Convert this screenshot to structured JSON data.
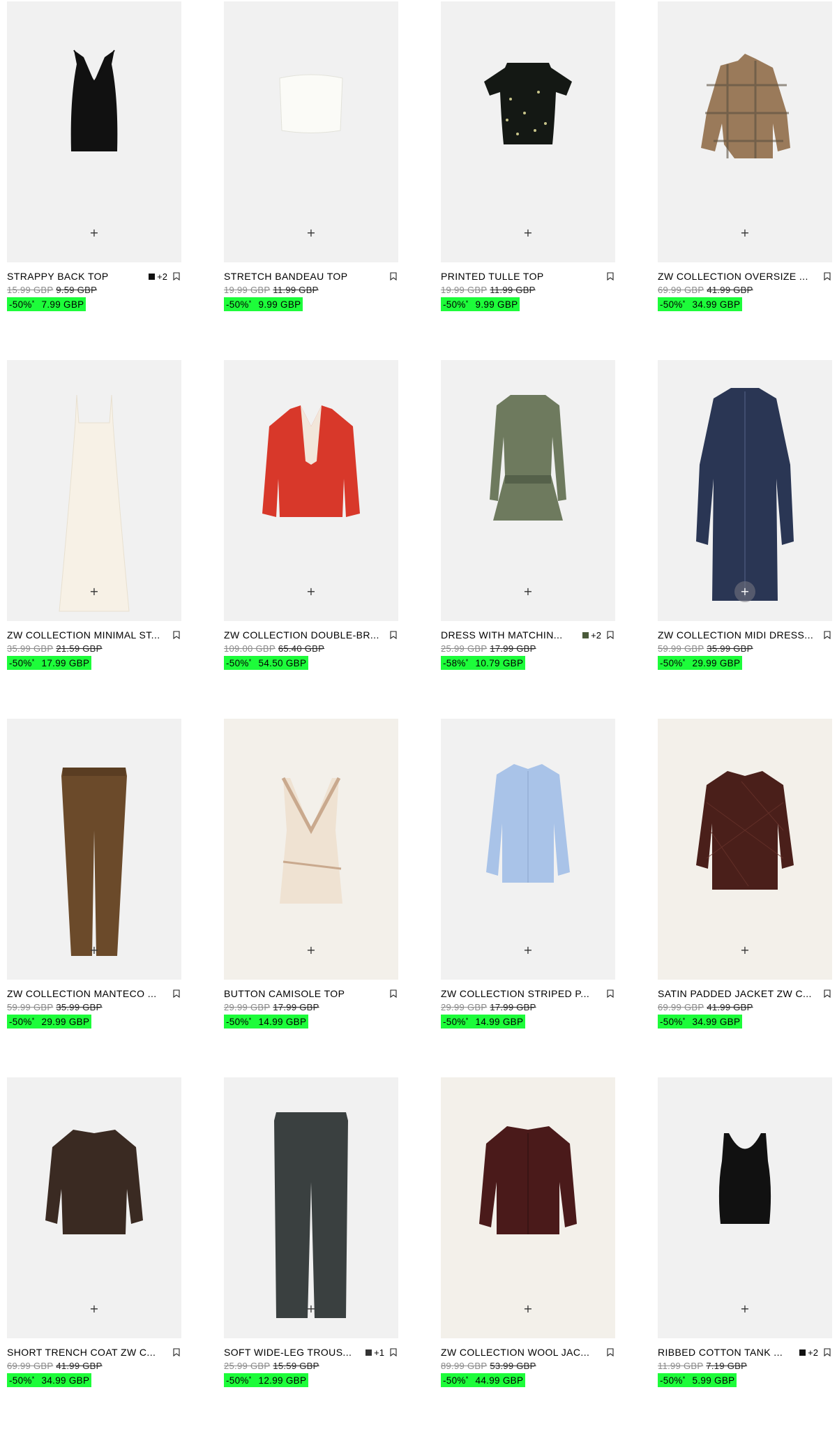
{
  "colors": {
    "card_bg": "#f1f1f1",
    "sale_bg": "#1dfc3a",
    "old_price": "#8a8a8a"
  },
  "products": [
    {
      "name": "STRAPPY BACK TOP",
      "swatch": {
        "color": "#111111",
        "more": "+2"
      },
      "old_price": "15.99 GBP",
      "mid_price": "9.59 GBP",
      "discount": "-50%",
      "sale_price": "7.99 GBP",
      "garment": "halter-top-black"
    },
    {
      "name": "STRETCH BANDEAU TOP",
      "old_price": "19.99 GBP",
      "mid_price": "11.99 GBP",
      "discount": "-50%",
      "sale_price": "9.99 GBP",
      "garment": "bandeau-white"
    },
    {
      "name": "PRINTED TULLE TOP",
      "old_price": "19.99 GBP",
      "mid_price": "11.99 GBP",
      "discount": "-50%",
      "sale_price": "9.99 GBP",
      "garment": "off-shoulder-floral"
    },
    {
      "name": "ZW COLLECTION OVERSIZE ...",
      "old_price": "69.99 GBP",
      "mid_price": "41.99 GBP",
      "discount": "-50%",
      "sale_price": "34.99 GBP",
      "garment": "check-shirt"
    },
    {
      "name": "ZW COLLECTION MINIMAL ST...",
      "old_price": "35.99 GBP",
      "mid_price": "21.59 GBP",
      "discount": "-50%",
      "sale_price": "17.99 GBP",
      "garment": "slip-dress-cream"
    },
    {
      "name": "ZW COLLECTION DOUBLE-BR...",
      "old_price": "109.00 GBP",
      "mid_price": "65.40 GBP",
      "discount": "-50%",
      "sale_price": "54.50 GBP",
      "garment": "red-blazer"
    },
    {
      "name": "DRESS WITH MATCHIN...",
      "swatch": {
        "color": "#4a5a3a",
        "more": "+2"
      },
      "old_price": "25.99 GBP",
      "mid_price": "17.99 GBP",
      "discount": "-58%",
      "sale_price": "10.79 GBP",
      "garment": "olive-dress"
    },
    {
      "name": "ZW COLLECTION MIDI DRESS...",
      "old_price": "59.99 GBP",
      "mid_price": "35.99 GBP",
      "discount": "-50%",
      "sale_price": "29.99 GBP",
      "garment": "navy-shirt-dress"
    },
    {
      "name": "ZW COLLECTION MANTECO ...",
      "old_price": "59.99 GBP",
      "mid_price": "35.99 GBP",
      "discount": "-50%",
      "sale_price": "29.99 GBP",
      "garment": "brown-trousers"
    },
    {
      "name": "BUTTON CAMISOLE TOP",
      "old_price": "29.99 GBP",
      "mid_price": "17.99 GBP",
      "discount": "-50%",
      "sale_price": "14.99 GBP",
      "garment": "camisole-cream"
    },
    {
      "name": "ZW COLLECTION STRIPED P...",
      "old_price": "29.99 GBP",
      "mid_price": "17.99 GBP",
      "discount": "-50%",
      "sale_price": "14.99 GBP",
      "garment": "blue-shirt"
    },
    {
      "name": "SATIN PADDED JACKET ZW C...",
      "old_price": "69.99 GBP",
      "mid_price": "41.99 GBP",
      "discount": "-50%",
      "sale_price": "34.99 GBP",
      "garment": "quilted-jacket"
    },
    {
      "name": "SHORT TRENCH COAT ZW C...",
      "old_price": "69.99 GBP",
      "mid_price": "41.99 GBP",
      "discount": "-50%",
      "sale_price": "34.99 GBP",
      "garment": "short-trench"
    },
    {
      "name": "SOFT WIDE-LEG TROUS...",
      "swatch": {
        "color": "#333333",
        "more": "+1"
      },
      "old_price": "25.99 GBP",
      "mid_price": "15.59 GBP",
      "discount": "-50%",
      "sale_price": "12.99 GBP",
      "garment": "wide-leg-trousers"
    },
    {
      "name": "ZW COLLECTION WOOL JAC...",
      "old_price": "89.99 GBP",
      "mid_price": "53.99 GBP",
      "discount": "-50%",
      "sale_price": "44.99 GBP",
      "garment": "wool-jacket"
    },
    {
      "name": "RIBBED COTTON TANK ...",
      "swatch": {
        "color": "#111111",
        "more": "+2"
      },
      "old_price": "11.99 GBP",
      "mid_price": "7.19 GBP",
      "discount": "-50%",
      "sale_price": "5.99 GBP",
      "garment": "black-tank"
    }
  ],
  "quick_add_symbol": "+",
  "discount_note": "*"
}
